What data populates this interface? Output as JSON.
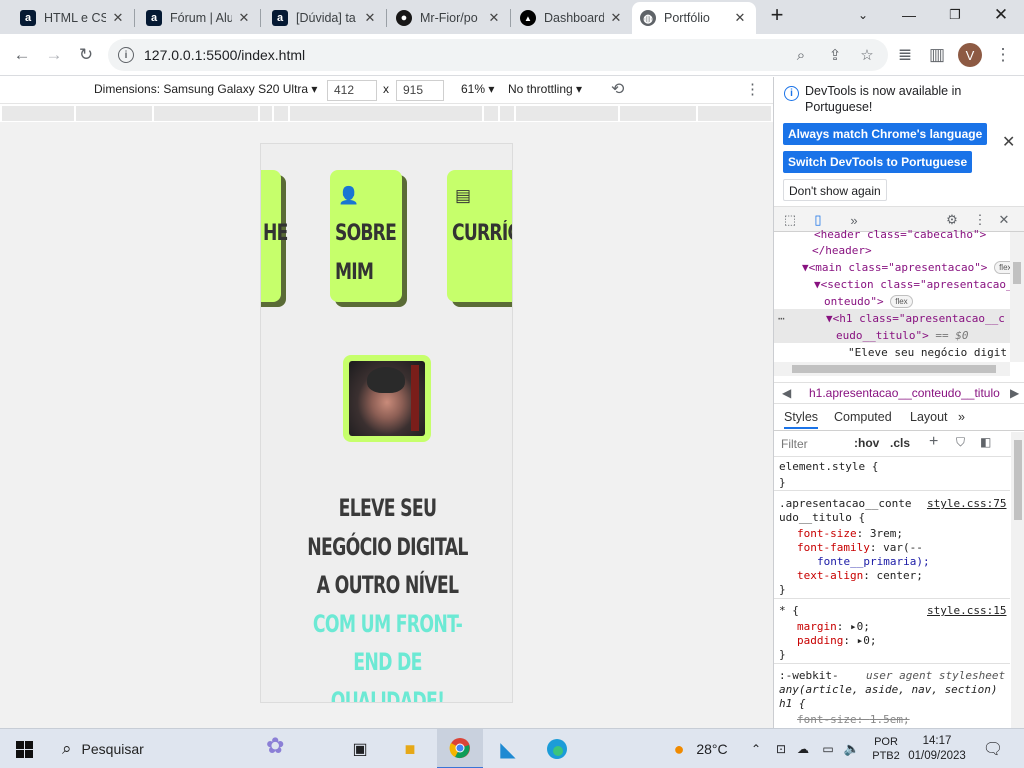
{
  "browser": {
    "tabs": [
      {
        "title": "HTML e CSS",
        "icon": "alura-icon"
      },
      {
        "title": "Fórum | Alu",
        "icon": "alura-icon"
      },
      {
        "title": "[Dúvida] ta",
        "icon": "alura-icon"
      },
      {
        "title": "Mr-Fior/po",
        "icon": "github-icon"
      },
      {
        "title": "Dashboard",
        "icon": "vercel-icon"
      },
      {
        "title": "Portfólio",
        "icon": "globe-icon",
        "active": true
      }
    ],
    "url": "127.0.0.1:5500/index.html",
    "profile_initial": "V"
  },
  "device_toolbar": {
    "dimensions_label": "Dimensions: Samsung Galaxy S20 Ultra",
    "width": "412",
    "height": "915",
    "times": "x",
    "zoom": "61%",
    "throttling": "No throttling"
  },
  "page": {
    "cards": [
      {
        "label": "HE",
        "icon": "home-icon"
      },
      {
        "label": "SOBRE MIM",
        "line1": "SOBRE",
        "line2": "MIM",
        "icon": "user-icon"
      },
      {
        "label": "CURRÍC",
        "icon": "document-icon"
      }
    ],
    "headline_lines": [
      "ELEVE SEU",
      "NEGÓCIO DIGITAL",
      "A OUTRO NÍVEL"
    ],
    "headline_accent_lines": [
      "COM UM FRONT-",
      "END DE",
      "QUALIDADE!"
    ]
  },
  "devtools": {
    "notice_text": "DevTools is now available in Portuguese!",
    "btn_match": "Always match Chrome's language",
    "btn_switch": "Switch DevTools to Portuguese",
    "btn_dont": "Don't show again",
    "elements": {
      "line1_tag": "<header class=\"cabecalho\">",
      "line2_tag": "</header>",
      "line3_tag": "<main class=\"apresentacao\">",
      "line3_badge": "flex",
      "line4_tag": "<section class=\"apresentacao__c",
      "line5_tag": "onteudo\">",
      "line5_badge": "flex",
      "line6_tag": "<h1 class=\"apresentacao__c",
      "line7_tag": "eudo__titulo\">",
      "line7_eq": "== $0",
      "line8_text": "\"Eleve seu negócio digit"
    },
    "breadcrumb": "h1.apresentacao__conteudo__titulo",
    "style_tabs": [
      "Styles",
      "Computed",
      "Layout"
    ],
    "filter_placeholder": "Filter",
    "hov": ":hov",
    "cls": ".cls",
    "rules": {
      "element_style": "element.style {",
      "close": "}",
      "sel1a": ".apresentacao__conte",
      "sel1b": "udo__titulo {",
      "link1": "style.css:75",
      "p1": "font-size",
      "v1": "3rem;",
      "p2": "font-family",
      "v2a": "var(--",
      "v2b": "fonte__primaria);",
      "p3": "text-align",
      "v3": "center;",
      "sel2": "* {",
      "link2": "style.css:15",
      "p4": "margin",
      "v4": "0;",
      "p5": "padding",
      "v5": "0;",
      "sel3a": ":-webkit-",
      "sel3b": "any(article, aside, nav, section)",
      "sel3c": "h1 {",
      "uas": "user agent stylesheet",
      "p6": "font-size",
      "v6": "1.5em;"
    }
  },
  "taskbar": {
    "search": "Pesquisar",
    "weather": "28°C",
    "lang1": "POR",
    "lang2": "PTB2",
    "time": "14:17",
    "date": "01/09/2023"
  },
  "colors": {
    "accent_lime": "#c6ff6b",
    "accent_cyan": "#6ce9d4",
    "chrome_blue": "#1a73e8"
  }
}
